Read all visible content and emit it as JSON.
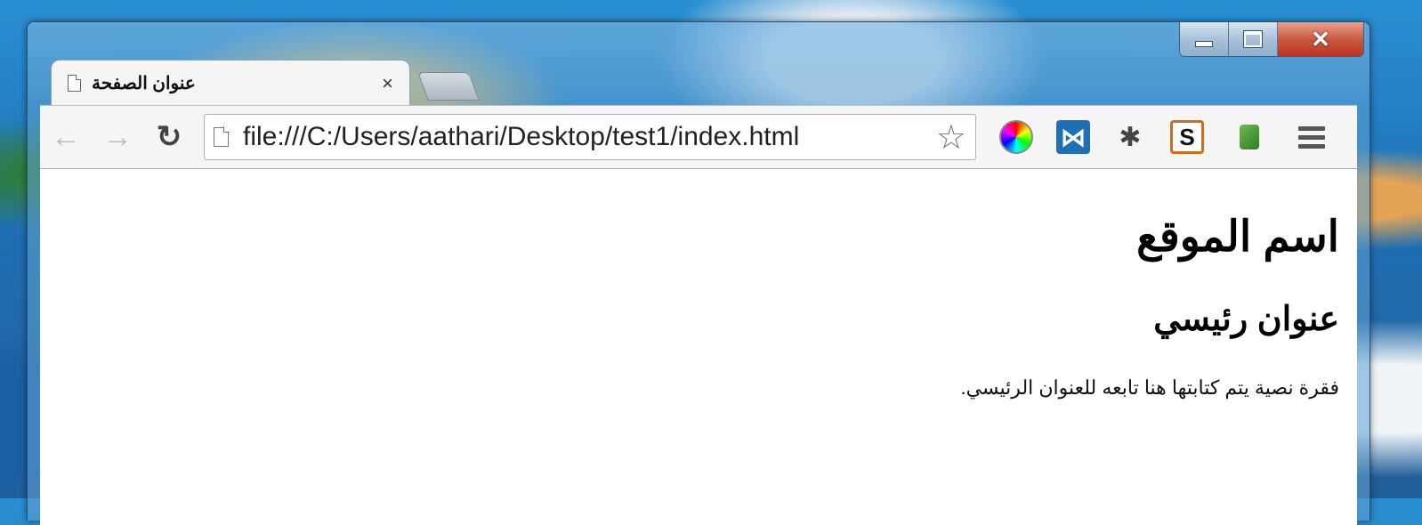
{
  "window": {
    "controls": {
      "minimize": "minimize",
      "maximize": "maximize",
      "close": "✕"
    }
  },
  "tab": {
    "title": "عنوان الصفحة",
    "close_label": "×"
  },
  "toolbar": {
    "back_glyph": "←",
    "forward_glyph": "→",
    "reload_glyph": "↻",
    "url": "file:///C:/Users/aathari/Desktop/test1/index.html",
    "star_glyph": "☆",
    "extensions": [
      "color-picker-icon",
      "vs-code-icon",
      "bug-icon",
      "s-extension-icon",
      "push-pin-icon"
    ],
    "s_label": "S"
  },
  "page": {
    "site_name": "اسم الموقع",
    "main_heading": "عنوان رئيسي",
    "paragraph": "فقرة نصية يتم كتابتها هنا تابعه للعنوان الرئيسي."
  }
}
